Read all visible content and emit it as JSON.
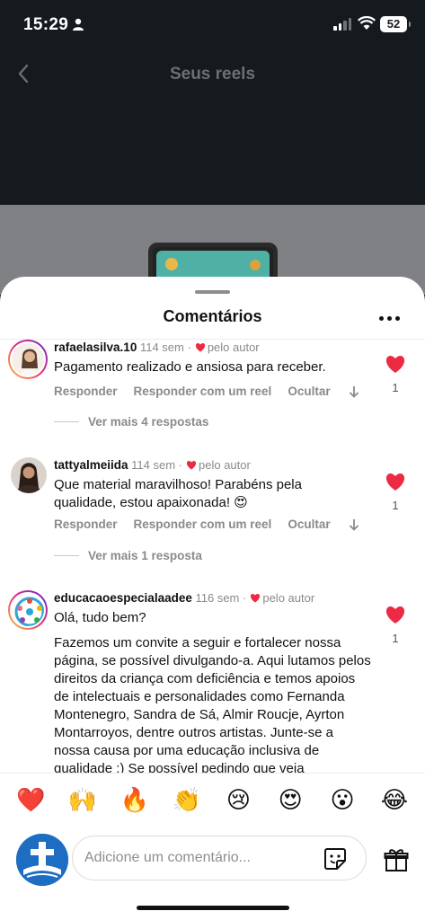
{
  "status_bar": {
    "time": "15:29",
    "battery": "52"
  },
  "header": {
    "title": "Seus reels"
  },
  "sheet": {
    "title": "Comentários"
  },
  "comments": [
    {
      "username": "rafaelasilva.10",
      "age": "114 sem",
      "author_like": "pelo autor",
      "text": "Pagamento realizado e ansiosa para receber.",
      "reply": "Responder",
      "reply_reel": "Responder com um reel",
      "hide": "Ocultar",
      "likes": "1",
      "more_replies": "Ver mais 4 respostas"
    },
    {
      "username": "tattyalmeiida",
      "age": "114 sem",
      "author_like": "pelo autor",
      "text": "Que material maravilhoso! Parabéns pela qualidade, estou apaixonada! 😍",
      "reply": "Responder",
      "reply_reel": "Responder com um reel",
      "hide": "Ocultar",
      "likes": "1",
      "more_replies": "Ver mais 1 resposta"
    },
    {
      "username": "educacaoespecialaadee",
      "age": "116 sem",
      "author_like": "pelo autor",
      "text_line1": "Olá, tudo bem?",
      "text": "Fazemos um convite a seguir e fortalecer nossa página, se possível divulgando-a. Aqui lutamos pelos direitos da criança com deficiência e temos apoios de intelectuais e personalidades como Fernanda Montenegro, Sandra de Sá, Almir Roucje, Ayrton Montarroyos, dentre outros artistas. Junte-se a nossa causa por uma educação inclusiva de qualidade :) Se possível pedindo que veja",
      "likes": "1"
    }
  ],
  "emoji_bar": [
    "❤️",
    "🙌",
    "🔥",
    "👏",
    "😢",
    "😍",
    "😮",
    "😂"
  ],
  "composer": {
    "placeholder": "Adicione um comentário..."
  },
  "colors": {
    "like_red": "#ed2a44",
    "sheet_bg": "#ffffff",
    "dim_bg": "#151a1f"
  }
}
